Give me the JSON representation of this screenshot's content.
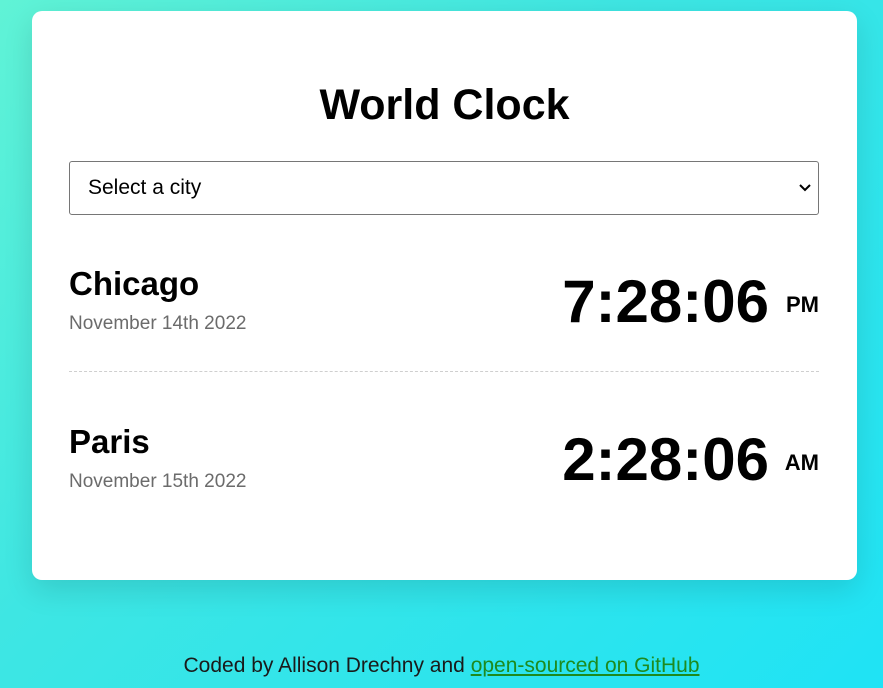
{
  "app": {
    "title": "World Clock"
  },
  "city_select": {
    "selected_label": "Select a city"
  },
  "cities": [
    {
      "name": "Chicago",
      "date": "November 14th 2022",
      "time": "7:28:06",
      "ampm": "PM"
    },
    {
      "name": "Paris",
      "date": "November 15th 2022",
      "time": "2:28:06",
      "ampm": "AM"
    }
  ],
  "footer": {
    "text": "Coded by Allison Drechny and",
    "link_text": "open-sourced on GitHub"
  },
  "colors": {
    "background_gradient_start": "#60f3d6",
    "background_gradient_end": "#1fe3f5",
    "card": "#ffffff",
    "link": "#1e8a1e",
    "date_text": "#6b6b6b"
  },
  "icons": {
    "select_arrow": "chevron-down-icon"
  }
}
